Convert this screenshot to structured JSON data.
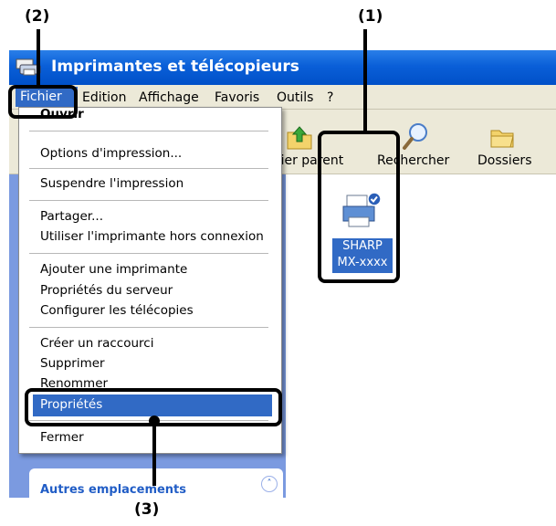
{
  "callouts": {
    "c1": "(1)",
    "c2": "(2)",
    "c3": "(3)"
  },
  "window": {
    "title": "Imprimantes et télécopieurs"
  },
  "menu": {
    "fichier": "Fichier",
    "edition": "Edition",
    "affichage": "Affichage",
    "favoris": "Favoris",
    "outils": "Outils",
    "help": "?"
  },
  "toolbar": {
    "parent": "ssier parent",
    "rechercher": "Rechercher",
    "dossiers": "Dossiers"
  },
  "dropdown": {
    "ouvrir": "Ouvrir",
    "options": "Options d'impression...",
    "suspendre": "Suspendre l'impression",
    "partager": "Partager...",
    "hors_connexion": "Utiliser l'imprimante hors connexion",
    "ajouter": "Ajouter une imprimante",
    "proprietes_serveur": "Propriétés du serveur",
    "telecopies": "Configurer les télécopies",
    "raccourci": "Créer un raccourci",
    "supprimer": "Supprimer",
    "renommer": "Renommer",
    "proprietes": "Propriétés",
    "fermer": "Fermer"
  },
  "printer": {
    "line1": "SHARP",
    "line2": "MX-xxxx"
  },
  "sidepanel": {
    "autres": "Autres emplacements"
  },
  "colors": {
    "titlebar": "#0a5fd8",
    "menubar": "#ece9d8",
    "highlight": "#316ac5",
    "sidepanel": "#7b9ae0"
  }
}
